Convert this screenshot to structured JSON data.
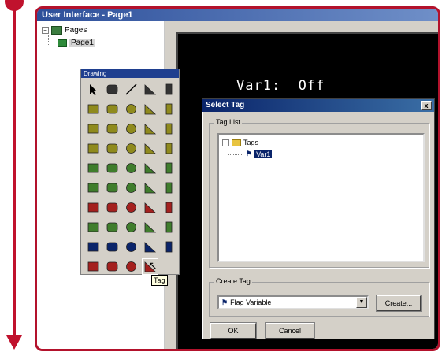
{
  "window": {
    "title": "User Interface - Page1"
  },
  "tree": {
    "root_label": "Pages",
    "child_label": "Page1"
  },
  "canvas": {
    "var_text": "Var1:  Off"
  },
  "toolbox": {
    "title": "Drawing",
    "tooltip": "Tag"
  },
  "tool_icons": [
    "arrow-pointer-icon",
    "lock-icon",
    "line-icon",
    "rectangle-icon",
    "rounded-rect-icon",
    "block-icon",
    "triangle-icon",
    "ellipse-icon",
    "quarter-pie-icon",
    "half-ellipse-icon",
    "meter-icon",
    "bargraph-icon",
    "chart-icon",
    "chart-alt-icon",
    "scatter-icon",
    "pipe-icon",
    "pipe-h-icon",
    "tank-icon",
    "tank-alt-icon",
    "panel-icon",
    "digital-display-icon",
    "counter-display-icon",
    "text-display-icon",
    "numeric-display-icon",
    "numeric-display-alt-icon",
    "pushbutton-icon",
    "switch-icon",
    "slider-icon",
    "level-icon",
    "battery-icon",
    "alarm-icon",
    "stop-button-icon",
    "panel-light-icon",
    "minus-button-icon",
    "plus-button-icon",
    "flag-icon",
    "lamp-icon",
    "fan-icon",
    "fan-alt-icon",
    "display-icon",
    "gauge-icon",
    "gauge-alt-icon",
    "dial-icon",
    "half-dial-icon",
    "wedge-icon",
    "picture-icon",
    "label-icon",
    "camera-icon",
    "tag-icon"
  ],
  "colors": {
    "accent_red": "#c0122d",
    "title_blue": "#0a246a",
    "tool_green": "#3f7d2c",
    "tool_olive": "#8f8a1d",
    "tool_red": "#a4201e"
  },
  "dialog": {
    "title": "Select Tag",
    "close": "x",
    "tag_list_label": "Tag List",
    "tree_root": "Tags",
    "tree_child": "Var1",
    "create_tag_label": "Create Tag",
    "combo_value": "Flag Variable",
    "create_button": "Create...",
    "ok_button": "OK",
    "cancel_button": "Cancel"
  }
}
